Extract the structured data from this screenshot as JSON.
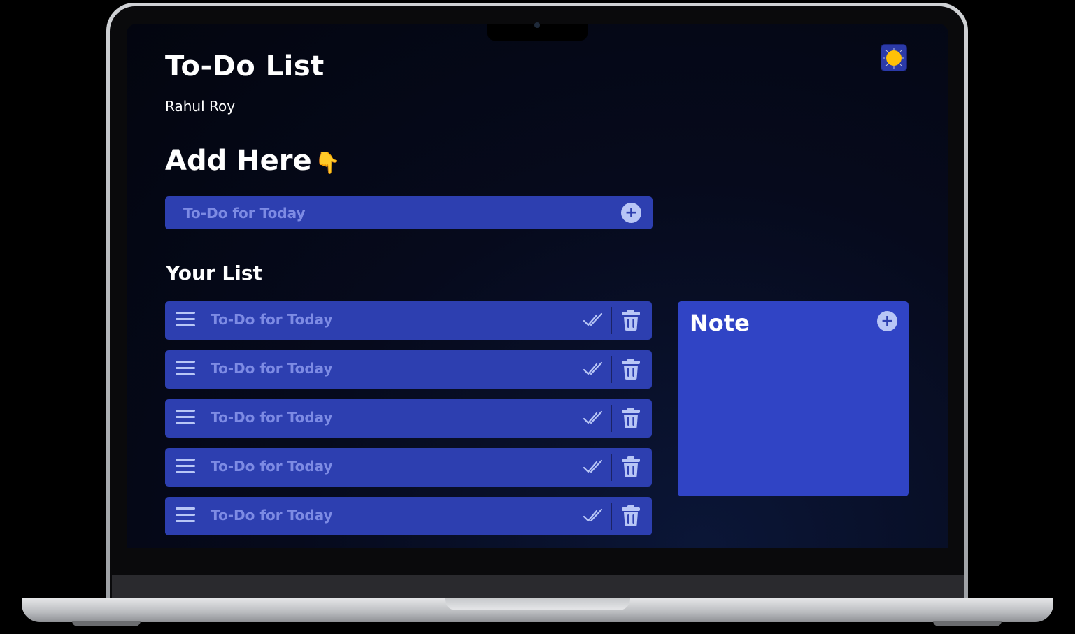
{
  "app": {
    "title": "To-Do List",
    "author": "Rahul Roy"
  },
  "theme_toggle": {
    "icon": "sun-icon"
  },
  "add_section": {
    "heading": "Add Here",
    "heading_emoji": "👇",
    "input_placeholder": "To-Do for Today",
    "input_value": "",
    "add_icon": "plus-icon"
  },
  "list_section": {
    "heading": "Your List",
    "items": [
      {
        "text": "To-Do for Today"
      },
      {
        "text": "To-Do for Today"
      },
      {
        "text": "To-Do for Today"
      },
      {
        "text": "To-Do for Today"
      },
      {
        "text": "To-Do for Today"
      }
    ]
  },
  "note": {
    "title": "Note",
    "add_icon": "plus-icon"
  },
  "colors": {
    "background": "#060a1c",
    "card": "#2d3fb0",
    "note_card": "#3044c5",
    "placeholder_text": "#7d8be4",
    "icon": "#b8c6f6",
    "sun": "#ffc107"
  }
}
